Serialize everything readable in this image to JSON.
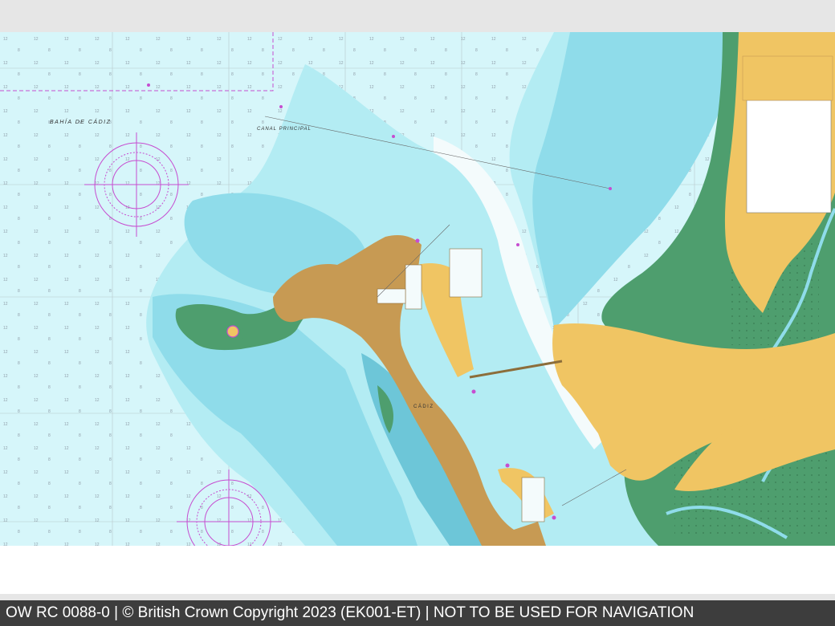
{
  "footer": {
    "text": "OW RC 0088-0 | © British Crown Copyright 2023 (EK001-ET) | NOT TO BE USED FOR NAVIGATION"
  },
  "map": {
    "labels": {
      "bay_name": "BAHÍA DE CÁDIZ",
      "channel_name": "CANAL PRINCIPAL",
      "city_name": "CÁDIZ"
    },
    "colors": {
      "deep_water": "#d6f6fa",
      "shallow_water_light": "#b3ecf3",
      "shallow_water": "#8fdcea",
      "shallow_water_dark": "#6dc6d8",
      "drying_area": "#4e9e6e",
      "land_builtup": "#c79a53",
      "land": "#f0c563",
      "magenta_features": "#c64dd0",
      "footer_background": "#3d3d3d"
    }
  }
}
